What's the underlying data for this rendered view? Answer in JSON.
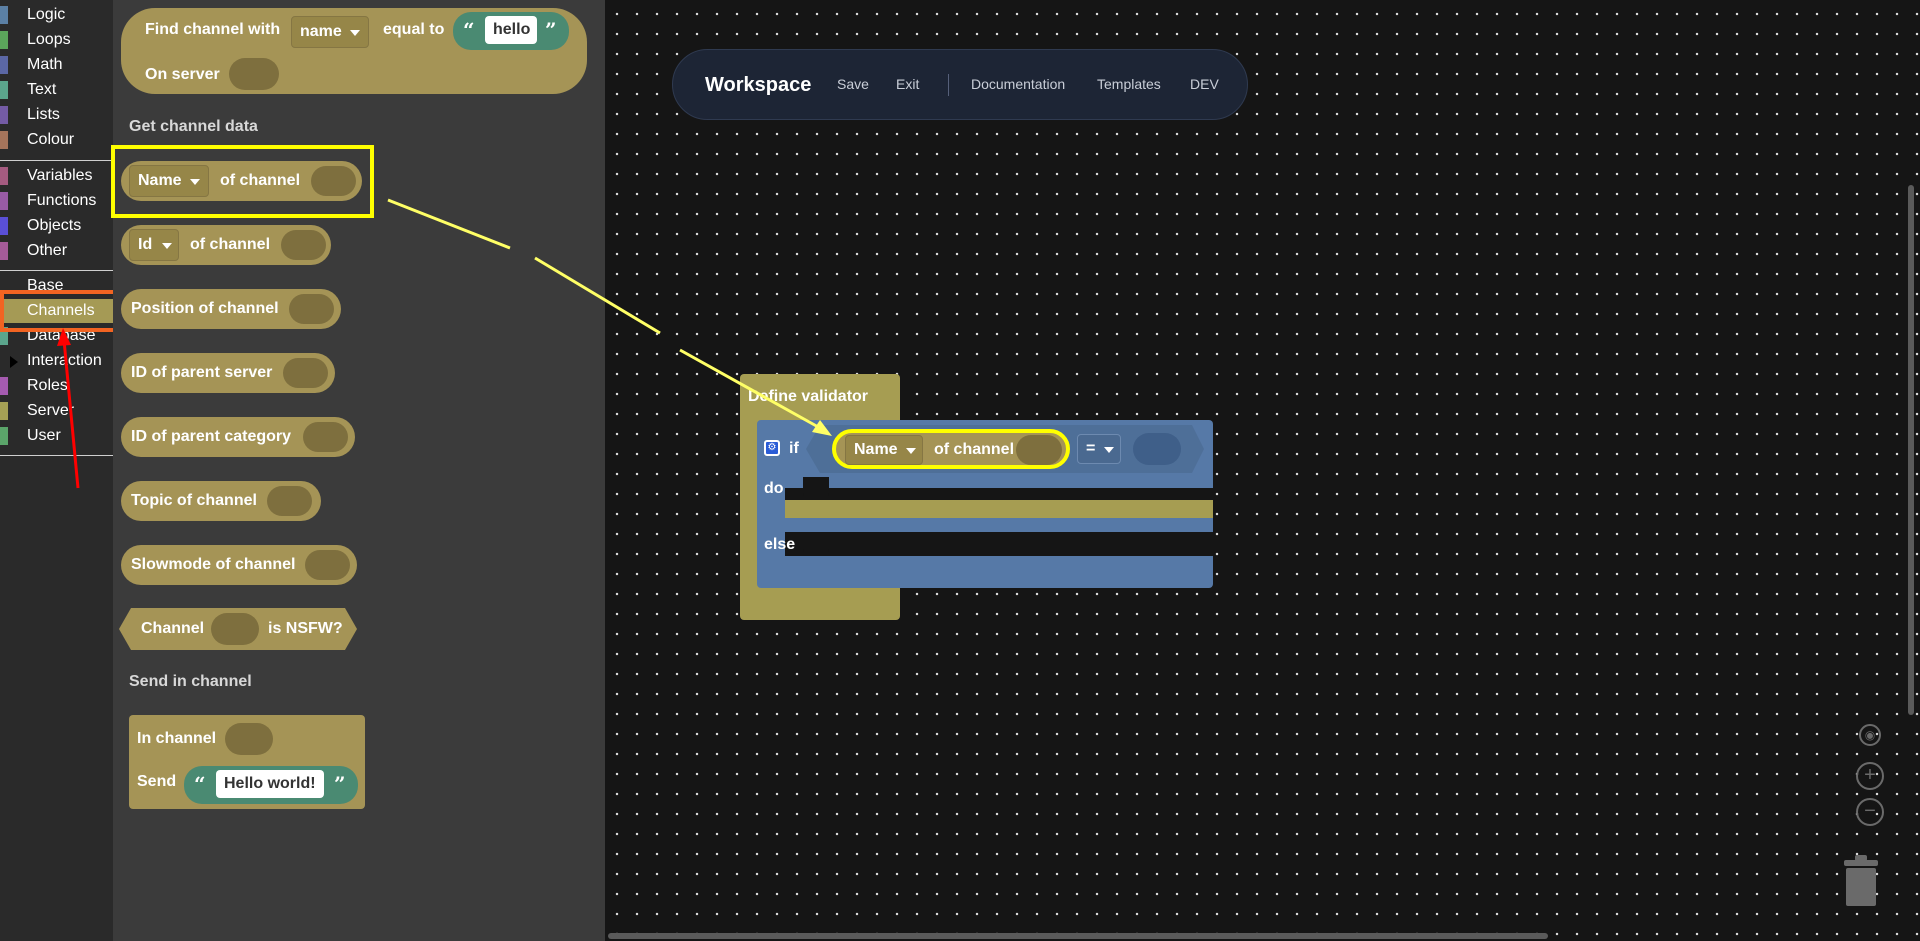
{
  "sidebar": {
    "categories": [
      {
        "label": "Logic",
        "color": "#5b80a5"
      },
      {
        "label": "Loops",
        "color": "#5ba55b"
      },
      {
        "label": "Math",
        "color": "#5b67a5"
      },
      {
        "label": "Text",
        "color": "#5ba58c"
      },
      {
        "label": "Lists",
        "color": "#745ba5"
      },
      {
        "label": "Colour",
        "color": "#a5745b"
      },
      {
        "label": "Variables",
        "color": "#a55b80"
      },
      {
        "label": "Functions",
        "color": "#995ba5"
      },
      {
        "label": "Objects",
        "color": "#5a4fd6"
      },
      {
        "label": "Other",
        "color": "#a55b99"
      },
      {
        "label": "Base",
        "color": "#2a2a2a"
      },
      {
        "label": "Channels",
        "color": "#a59a55"
      },
      {
        "label": "Database",
        "color": "#5ba58c"
      },
      {
        "label": "Interaction",
        "color": "#6a2a8a"
      },
      {
        "label": "Roles",
        "color": "#a55bb0"
      },
      {
        "label": "Server",
        "color": "#a5a055"
      },
      {
        "label": "User",
        "color": "#5ba56a"
      }
    ],
    "selected": "Channels"
  },
  "flyout": {
    "find_block": {
      "prefix": "Find channel with",
      "field": "name",
      "middle": "equal to",
      "value": "hello",
      "server_label": "On server"
    },
    "section_get": "Get channel data",
    "name_block": {
      "field": "Name",
      "suffix": "of channel"
    },
    "id_block": {
      "field": "Id",
      "suffix": "of channel"
    },
    "position_block": "Position of channel",
    "parent_server_block": "ID of parent server",
    "parent_category_block": "ID of parent category",
    "topic_block": "Topic of channel",
    "slowmode_block": "Slowmode of channel",
    "nsfw_block": {
      "prefix": "Channel",
      "suffix": "is NSFW?"
    },
    "section_send": "Send in channel",
    "send_block": {
      "in_label": "In channel",
      "send_label": "Send",
      "value": "Hello world!"
    }
  },
  "topbar": {
    "brand": "Workspace",
    "save": "Save",
    "exit": "Exit",
    "documentation": "Documentation",
    "templates": "Templates",
    "dev": "DEV"
  },
  "workspace": {
    "validator_title": "Define validator",
    "if_label": "if",
    "do_label": "do",
    "else_label": "else",
    "cond_field": "Name",
    "cond_suffix": "of channel",
    "operator": "="
  },
  "zoom": {
    "reset_icon": "target-icon",
    "zoom_in_icon": "plus-icon",
    "zoom_out_icon": "minus-icon"
  },
  "colors": {
    "block_channel": "#a59456",
    "block_logic": "#5679a7",
    "highlight": "#ffff00",
    "selected_outline": "#f26422",
    "annotation_arrow": "#ff0000"
  }
}
